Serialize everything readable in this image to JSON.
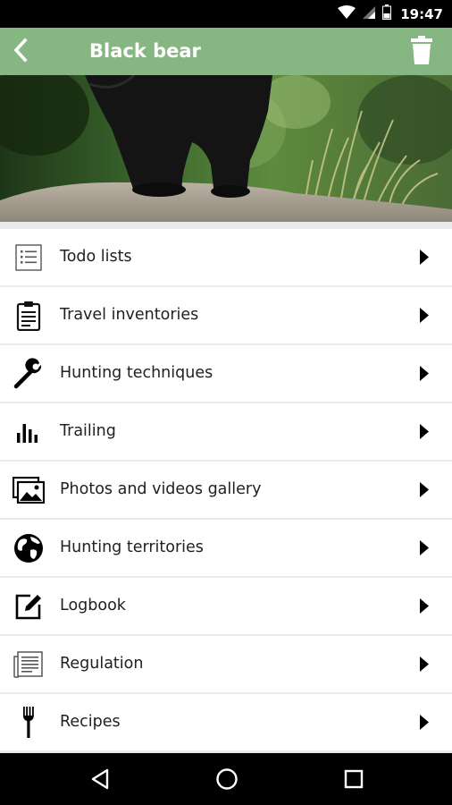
{
  "status_bar": {
    "time": "19:47",
    "icons": [
      "wifi-icon",
      "signal-icon",
      "battery-icon"
    ]
  },
  "app_bar": {
    "title": "Black bear",
    "background_color": "#86b783",
    "back_icon": "chevron-left-icon",
    "delete_icon": "trash-icon"
  },
  "hero_image": {
    "subject": "black bear standing on a rock"
  },
  "menu": {
    "items": [
      {
        "label": "Todo lists",
        "icon": "checklist-icon"
      },
      {
        "label": "Travel inventories",
        "icon": "clipboard-icon"
      },
      {
        "label": "Hunting techniques",
        "icon": "wrench-icon"
      },
      {
        "label": "Trailing",
        "icon": "bar-chart-icon"
      },
      {
        "label": "Photos and videos gallery",
        "icon": "photo-gallery-icon"
      },
      {
        "label": "Hunting territories",
        "icon": "globe-icon"
      },
      {
        "label": "Logbook",
        "icon": "edit-icon"
      },
      {
        "label": "Regulation",
        "icon": "document-icon"
      },
      {
        "label": "Recipes",
        "icon": "fork-icon"
      }
    ],
    "arrow_icon": "caret-right-icon"
  },
  "nav_bar": {
    "buttons": [
      "back-triangle-icon",
      "home-circle-icon",
      "recents-square-icon"
    ]
  }
}
